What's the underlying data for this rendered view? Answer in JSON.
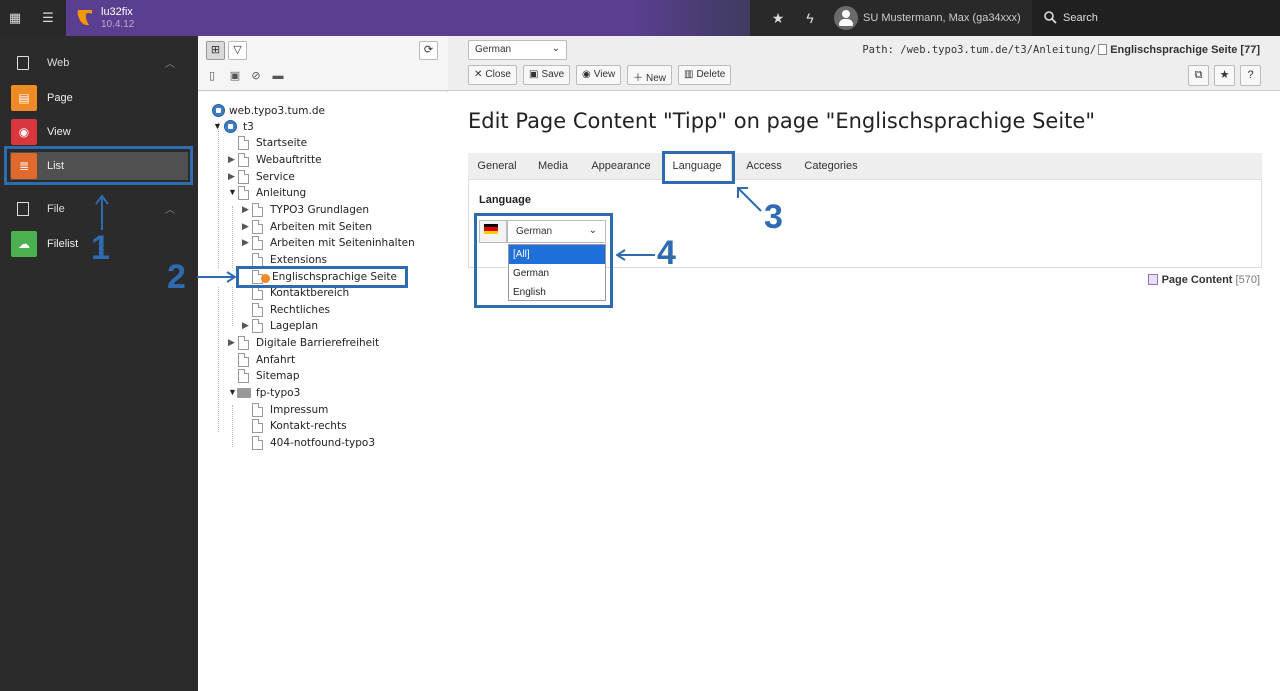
{
  "topbar": {
    "site_name": "lu32fix",
    "site_version": "10.4.12",
    "user_name": "SU Mustermann, Max (ga34xxx)",
    "search_label": "Search"
  },
  "modmenu": {
    "groups": [
      {
        "label": "Web",
        "items": [
          "Page",
          "View",
          "List"
        ]
      },
      {
        "label": "File",
        "items": [
          "Filelist"
        ]
      }
    ],
    "active_item": "List"
  },
  "tree": {
    "nodes": [
      {
        "label": "web.typo3.tum.de"
      },
      {
        "label": "t3"
      },
      {
        "label": "Startseite"
      },
      {
        "label": "Webauftritte"
      },
      {
        "label": "Service"
      },
      {
        "label": "Anleitung"
      },
      {
        "label": "TYPO3 Grundlagen"
      },
      {
        "label": "Arbeiten mit Seiten"
      },
      {
        "label": "Arbeiten mit Seiteninhalten"
      },
      {
        "label": "Extensions"
      },
      {
        "label": "Englischsprachige Seite"
      },
      {
        "label": "Kontaktbereich"
      },
      {
        "label": "Rechtliches"
      },
      {
        "label": "Lageplan"
      },
      {
        "label": "Digitale Barrierefreiheit"
      },
      {
        "label": "Anfahrt"
      },
      {
        "label": "Sitemap"
      },
      {
        "label": "fp-typo3"
      },
      {
        "label": "Impressum"
      },
      {
        "label": "Kontakt-rechts"
      },
      {
        "label": "404-notfound-typo3"
      }
    ]
  },
  "docheader": {
    "language_select": "German",
    "buttons": [
      "Close",
      "Save",
      "View",
      "New",
      "Delete"
    ],
    "path_prefix": "Path: /web.typo3.tum.de/t3/Anleitung/",
    "path_page": "Englischsprachige Seite [77]"
  },
  "editor": {
    "title": "Edit Page Content \"Tipp\" on page \"Englischsprachige Seite\"",
    "tabs": [
      "General",
      "Media",
      "Appearance",
      "Language",
      "Access",
      "Categories"
    ],
    "active_tab": "Language",
    "field_label": "Language",
    "language_value": "German",
    "dropdown_options": [
      "[All]",
      "German",
      "English"
    ],
    "dropdown_selected": "[All]",
    "record_type": "Page Content",
    "record_uid": "[570]"
  },
  "annotations": [
    "1",
    "2",
    "3",
    "4"
  ],
  "colors": {
    "brand_purple": "#5a3f91",
    "annotation_blue": "#2e6bb0",
    "page_orange": "#f08a24",
    "view_red": "#d9363e",
    "list_orange": "#e1692b",
    "filelist_green": "#4caf50"
  }
}
